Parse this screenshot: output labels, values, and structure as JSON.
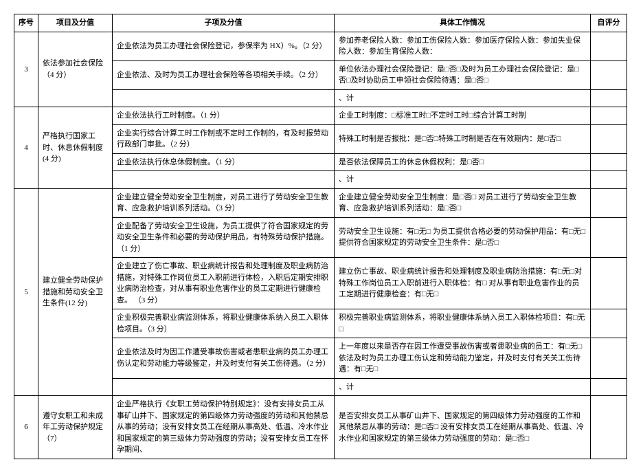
{
  "headers": {
    "no": "序号",
    "item": "项目及分值",
    "sub": "子项及分值",
    "work": "具体工作情况",
    "score": "自评分"
  },
  "rows": [
    {
      "no": "3",
      "item": "依法参加社会保险（4 分）",
      "subs": [
        {
          "sub": "企业依法为员工办理社会保险登记，参保率为 HX）%。（2 分）",
          "work": "参加养老保险人数：参加工伤保险人数：参加医疗保险人数：参加失业保险人数：参加生育保险人数：",
          "score": ""
        },
        {
          "sub": "企业依法、及时为员工办理社会保险等各项相关手续。（2 分）",
          "work": "单位依法办理社会保险登记：是□否□及时为员工办理社会保险登记：是□否□及时协助员工申领社会保险待遇：是□否□",
          "score": ""
        },
        {
          "sub": "",
          "work": "、计",
          "score": ""
        }
      ]
    },
    {
      "no": "4",
      "item": "严格执行国家工时、休息休假制度(4 分)",
      "subs": [
        {
          "sub": "企业依法执行工时制度。（1 分）",
          "work": "企业工时制度：□标准工时□不定时工时□综合计算工时制",
          "score": ""
        },
        {
          "sub": "企业实行综合计算工时工作制或不定时工作制的，有及时报劳动行政部门审批。（2 分）",
          "work": "特殊工时制是否报批：是□否□特殊工时制是否在有效期内：是□否□",
          "score": ""
        },
        {
          "sub": "企业依法执行休息休假制度。（1 分）",
          "work": "是否依法保障员工的休息休假权利：是□否□",
          "score": ""
        },
        {
          "sub": "",
          "work": "、计",
          "score": ""
        }
      ]
    },
    {
      "no": "5",
      "item": "建立健全劳动保护措施和劳动安全卫生条件(12 分)",
      "subs": [
        {
          "sub": "企业建立健全劳动安全卫生制度，对员工进行了劳动安全卫生教育、应急救护培训系列活动。（3 分）",
          "work": "企业建立健全劳动安全卫生制度：是□否□\n对员工进行了劳动安全卫生教育、应急救护培训系列活动：是□否□",
          "score": ""
        },
        {
          "sub": "企业配备了劳动安全卫生设施，为员工提供了符合国家规定的劳动安全卫生条件和必要的劳动保护用品，有特殊劳动保护措施。（1 分）",
          "work": "劳动安全卫生设施：有□无□\n为员工提供合格必要的劳动保护用品：有□无□提供符合国家规定的劳动安全卫生条件：是□否□",
          "score": ""
        },
        {
          "sub": "企业建立了伤亡事故、职业病统计报告和处理制度及职业病防治措施，对特殊工作岗位员工入职前进行体检，入职后定期安排职业病防治检查，对从事有职业危害作业的员工定期进行健康检查。\n（3 分）",
          "work": "建立伤亡事故、职业病统计报告和处理制度及职业病防治措施：有□无□对特殊工作岗位员工入职前进行入职体检：有□\n对从事有职业危害作业的员工定期进行健康检查：有□无□",
          "score": ""
        },
        {
          "sub": "企业积极完善职业病监测体系，将职业健康体系纳入员工入职体检项目。（3 分）",
          "work": "积极完善职业病监测体系，将职业健康体系纳入员工入职体检项目：有□无□",
          "score": ""
        },
        {
          "sub": "企业依法及时为因工作遭受事故伤害或者患职业病的员工办理工伤认定和劳动能力等级鉴定，并及时支付有关工伤待遇。（2 分）",
          "work": "上一年度以来是否存在因工作遭受事故伤害或者患职业病的员工：有□无□\n依法及时为员工办理工伤认定和劳动能力鉴定，并及时支付有关关工伤待遇：有□无□",
          "score": ""
        },
        {
          "sub": "",
          "work": "、计",
          "score": ""
        }
      ]
    },
    {
      "no": "6",
      "item": "遵守女职工和未成年工劳动保护规定（7）",
      "subs": [
        {
          "sub": "企业严格执行《女职工劳动保护特别规定》：没有安排女员工从事矿山井下、国家规定的第四级体力劳动强度的劳动和其他禁忌从事的劳动；没有安排女员工在经期从事高处、低温、冷水作业和国家规定的第三级体力劳动强度的劳动；没有安排女员工在怀孕期间、",
          "work": "是否安排女员工从事矿山井下、国家规定的第四级体力劳动强度的工作和其他禁忌从事的劳动：是□否□\n没有安排女员工在经期从事高处、低温、冷水作业和国家规定的第三级体力劳动强度的劳动：是□否□",
          "score": ""
        }
      ]
    }
  ]
}
